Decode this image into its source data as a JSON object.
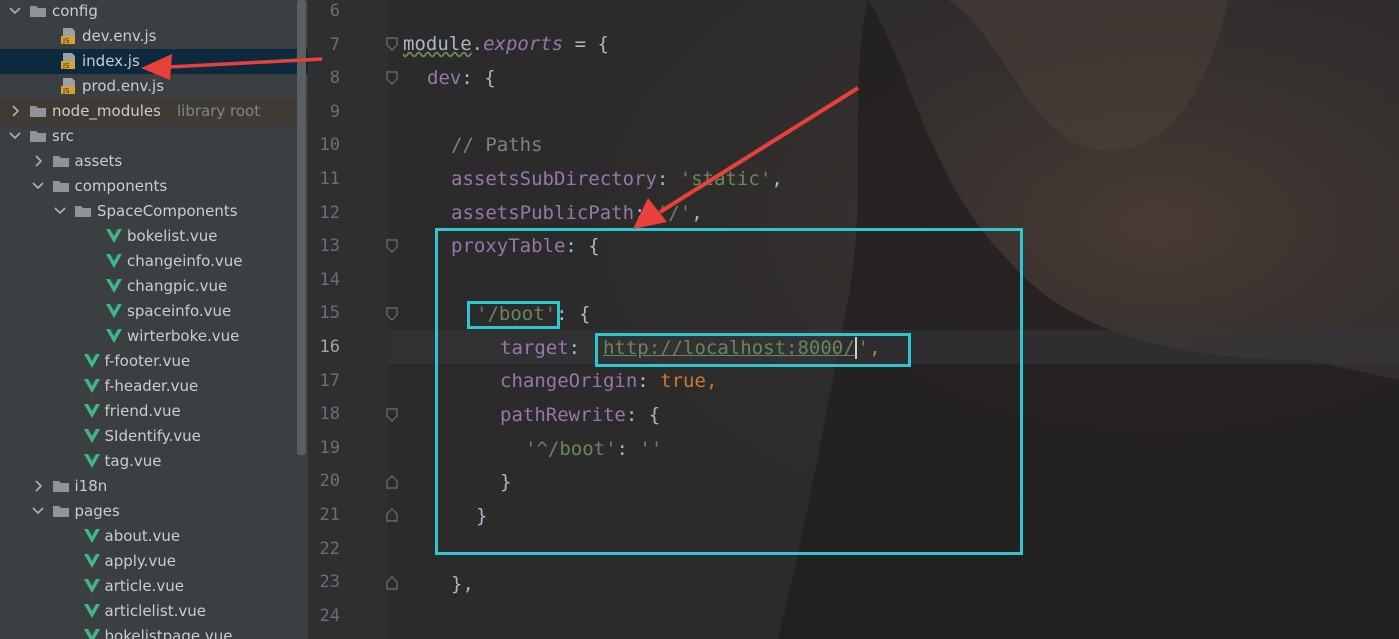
{
  "tree": {
    "items": [
      {
        "label": "config",
        "type": "folder",
        "expanded": true,
        "indent": 0
      },
      {
        "label": "dev.env.js",
        "type": "js",
        "indent": 2
      },
      {
        "label": "index.js",
        "type": "js",
        "indent": 2,
        "selected": true
      },
      {
        "label": "prod.env.js",
        "type": "js",
        "indent": 2
      },
      {
        "label": "node_modules",
        "type": "folder",
        "expanded": false,
        "indent": 0,
        "hint": "library root"
      },
      {
        "label": "src",
        "type": "folder",
        "expanded": true,
        "indent": 0
      },
      {
        "label": "assets",
        "type": "folder",
        "expanded": false,
        "indent": 1
      },
      {
        "label": "components",
        "type": "folder",
        "expanded": true,
        "indent": 1
      },
      {
        "label": "SpaceComponents",
        "type": "folder",
        "expanded": true,
        "indent": 2
      },
      {
        "label": "bokelist.vue",
        "type": "vue",
        "indent": 4
      },
      {
        "label": "changeinfo.vue",
        "type": "vue",
        "indent": 4
      },
      {
        "label": "changpic.vue",
        "type": "vue",
        "indent": 4
      },
      {
        "label": "spaceinfo.vue",
        "type": "vue",
        "indent": 4
      },
      {
        "label": "wirterboke.vue",
        "type": "vue",
        "indent": 4
      },
      {
        "label": "f-footer.vue",
        "type": "vue",
        "indent": 3
      },
      {
        "label": "f-header.vue",
        "type": "vue",
        "indent": 3
      },
      {
        "label": "friend.vue",
        "type": "vue",
        "indent": 3
      },
      {
        "label": "SIdentify.vue",
        "type": "vue",
        "indent": 3
      },
      {
        "label": "tag.vue",
        "type": "vue",
        "indent": 3
      },
      {
        "label": "i18n",
        "type": "folder",
        "expanded": false,
        "indent": 1
      },
      {
        "label": "pages",
        "type": "folder",
        "expanded": true,
        "indent": 1
      },
      {
        "label": "about.vue",
        "type": "vue",
        "indent": 3
      },
      {
        "label": "apply.vue",
        "type": "vue",
        "indent": 3
      },
      {
        "label": "article.vue",
        "type": "vue",
        "indent": 3
      },
      {
        "label": "articlelist.vue",
        "type": "vue",
        "indent": 3
      },
      {
        "label": "bokelistpage.vue",
        "type": "vue",
        "indent": 3
      }
    ]
  },
  "editor": {
    "current_line": "16",
    "line_numbers": [
      "6",
      "7",
      "8",
      "9",
      "10",
      "11",
      "12",
      "13",
      "14",
      "15",
      "16",
      "17",
      "18",
      "19",
      "20",
      "21",
      "22",
      "23",
      "24"
    ],
    "code": {
      "l7_module": "module",
      "l7_dot": ".",
      "l7_exports": "exports",
      "l7_rest": " = {",
      "l8_key": "dev",
      "l8_rest": ": {",
      "l10_comment": "// Paths",
      "l11_key": "assetsSubDirectory",
      "l11_colon": ": ",
      "l11_val": "'static'",
      "l11_comma": ",",
      "l12_key": "assetsPublicPath",
      "l12_colon": ": ",
      "l12_val": "'/'",
      "l12_comma": ",",
      "l13_key": "proxyTable",
      "l13_rest": ": {",
      "l15_key": "'/boot'",
      "l15_rest": ": {",
      "l16_key": "target",
      "l16_colon": ": ",
      "l16_q1": "'",
      "l16_url": "http://localhost:8000/",
      "l16_q2": "'",
      "l16_comma": ",",
      "l17_key": "changeOrigin",
      "l17_colon": ": ",
      "l17_val": "true",
      "l17_comma": ",",
      "l18_key": "pathRewrite",
      "l18_rest": ": {",
      "l19_key": "'^/boot'",
      "l19_colon": ": ",
      "l19_val": "''",
      "l20_close": "}",
      "l21_close": "}",
      "l23_close": "},"
    }
  },
  "colors": {
    "highlight_box": "#2fc6d0",
    "annotation_arrow": "#e8403a",
    "vue_icon": "#41b883",
    "js_icon": "#d4a43a"
  }
}
